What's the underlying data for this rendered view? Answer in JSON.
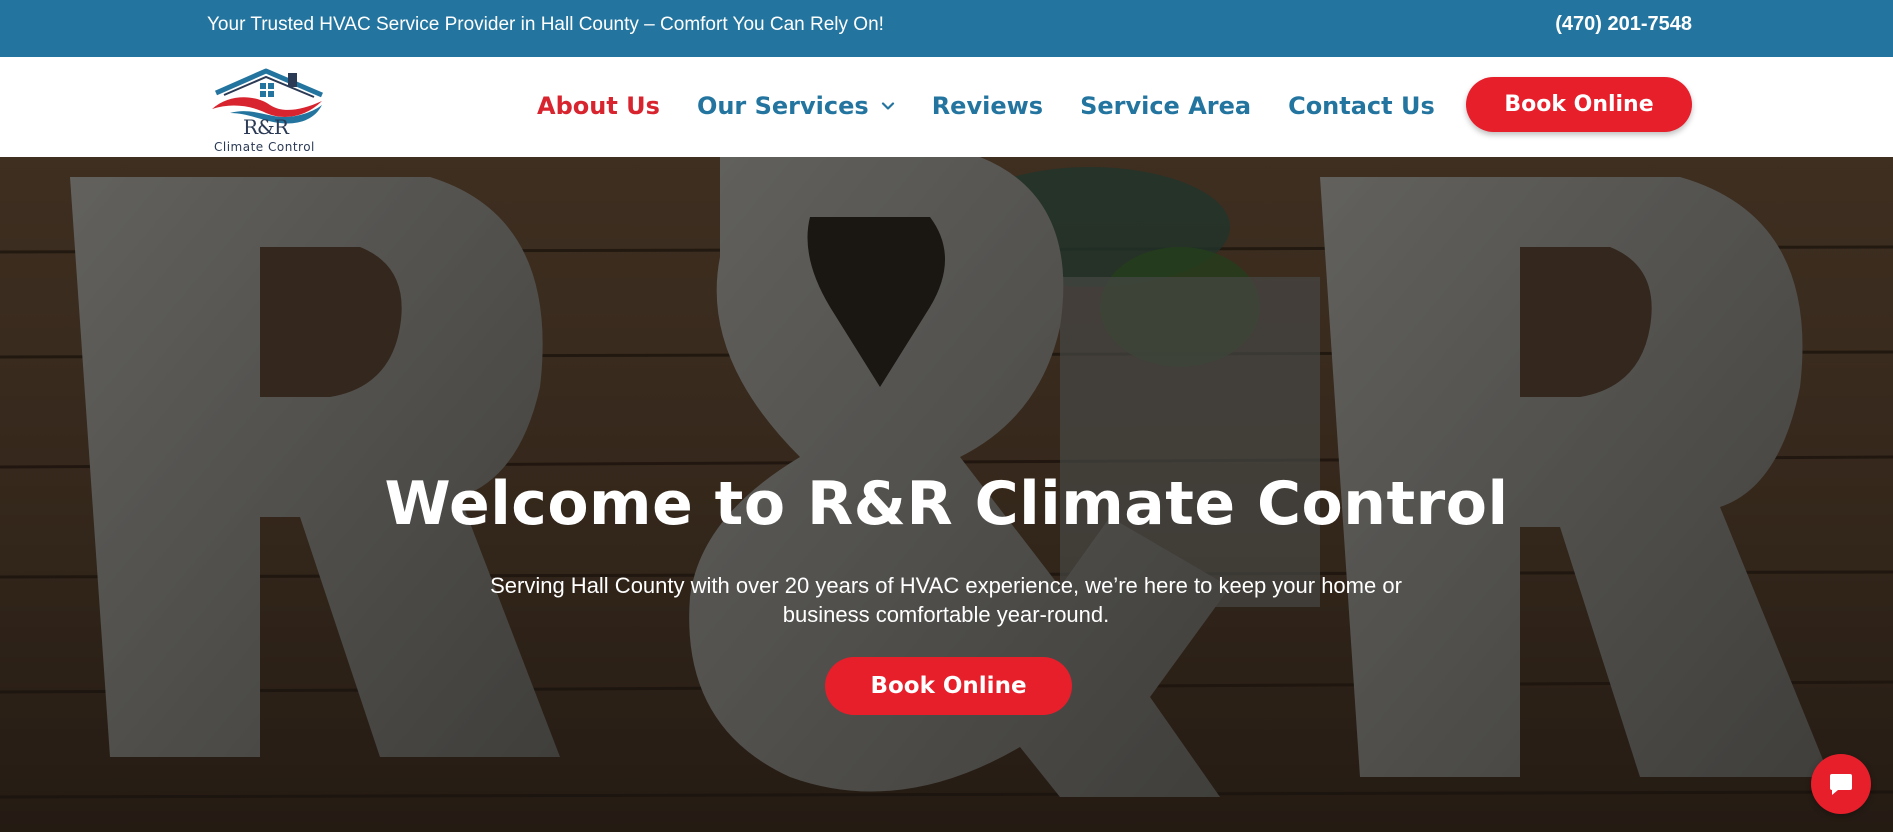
{
  "topbar": {
    "tagline": "Your Trusted HVAC Service Provider in Hall County – Comfort You Can Rely On!",
    "phone": "(470) 201-7548"
  },
  "logo": {
    "name": "R&R",
    "sub": "Climate Control"
  },
  "nav": {
    "items": [
      {
        "label": "About Us"
      },
      {
        "label": "Our Services"
      },
      {
        "label": "Reviews"
      },
      {
        "label": "Service Area"
      },
      {
        "label": "Contact Us"
      }
    ],
    "cta": "Book Online"
  },
  "hero": {
    "title": "Welcome to R&R Climate Control",
    "subtitle": "Serving Hall County with over 20 years of HVAC experience, we’re here to keep your home or business comfortable year-round.",
    "cta": "Book Online"
  },
  "colors": {
    "brand_blue": "#23759f",
    "brand_red": "#e61f2b",
    "active_red": "#d8242e"
  },
  "icons": {
    "nav_dropdown": "chevron-down-icon",
    "chat": "chat-bubble-icon"
  }
}
